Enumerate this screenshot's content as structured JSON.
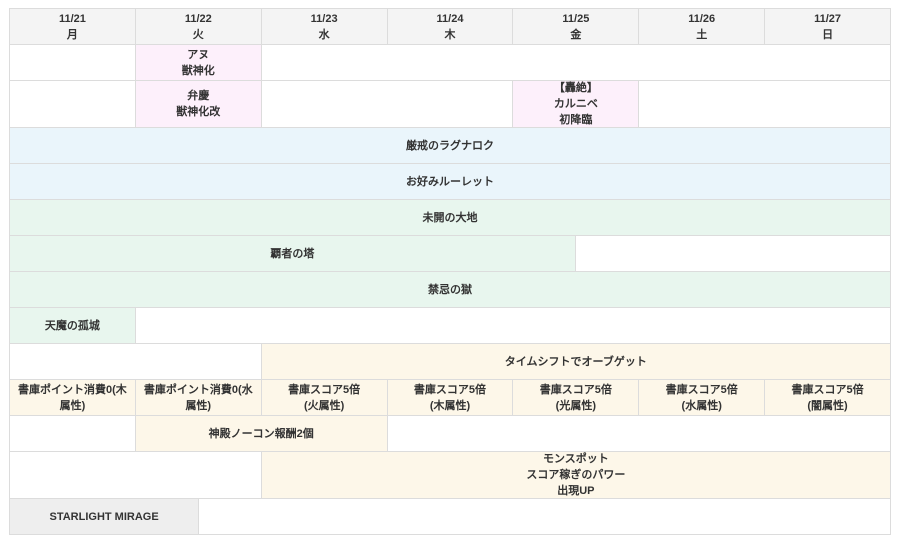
{
  "days": [
    {
      "date": "11/21",
      "weekday": "月"
    },
    {
      "date": "11/22",
      "weekday": "火"
    },
    {
      "date": "11/23",
      "weekday": "水"
    },
    {
      "date": "11/24",
      "weekday": "木"
    },
    {
      "date": "11/25",
      "weekday": "金"
    },
    {
      "date": "11/26",
      "weekday": "土"
    },
    {
      "date": "11/27",
      "weekday": "日"
    }
  ],
  "events": {
    "anu": "アヌ\n獣神化",
    "benkei": "弁慶\n獣神化改",
    "karunibe": "【轟絶】\nカルニベ\n初降臨",
    "ragnarok": "厳戒のラグナロク",
    "roulette": "お好みルーレット",
    "mikai": "未開の大地",
    "hasha": "覇者の塔",
    "kinki": "禁忌の獄",
    "tenma": "天魔の孤城",
    "timeshift": "タイムシフトでオーブゲット",
    "shoko_wood": "書庫ポイント消費0(木属性)",
    "shoko_water": "書庫ポイント消費0(水属性)",
    "score_fire": "書庫スコア5倍\n(火属性)",
    "score_wood": "書庫スコア5倍\n(木属性)",
    "score_light": "書庫スコア5倍\n(光属性)",
    "score_water": "書庫スコア5倍\n(水属性)",
    "score_dark": "書庫スコア5倍\n(闇属性)",
    "shinden": "神殿ノーコン報酬2個",
    "monspot": "モンスポット\nスコア稼ぎのパワー\n出現UP",
    "starlight": "STARLIGHT MIRAGE"
  }
}
